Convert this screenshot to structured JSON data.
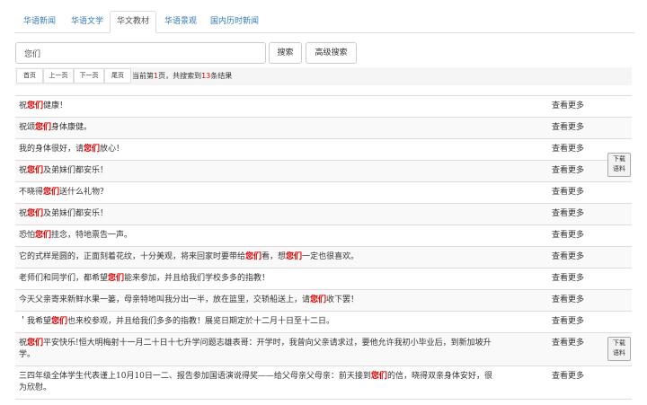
{
  "tabs": [
    {
      "label": "华语新闻"
    },
    {
      "label": "华语文学"
    },
    {
      "label": "华文教材",
      "active": true
    },
    {
      "label": "华语景观"
    },
    {
      "label": "国内历时新闻"
    }
  ],
  "search": {
    "value": "您们",
    "button_label": "搜索",
    "advanced_label": "高级搜索"
  },
  "pager": {
    "first": "首页",
    "prev": "上一页",
    "next": "下一页",
    "last": "尾页",
    "info_pre": "当前第",
    "current_page": "1",
    "info_mid": "页，共搜索到",
    "total": "13",
    "info_post": "条结果"
  },
  "results": [
    {
      "before": "祝",
      "keyword": "您们",
      "after": "健康！",
      "more": "查看更多"
    },
    {
      "before": "祝颂",
      "keyword": "您们",
      "after": "身体康健。",
      "more": "查看更多"
    },
    {
      "before": "我的身体很好，请",
      "keyword": "您们",
      "after": "放心！",
      "more": "查看更多"
    },
    {
      "before": "祝",
      "keyword": "您们",
      "after": "及弟妹们都安乐！",
      "more": "查看更多"
    },
    {
      "before": "不晓得",
      "keyword": "您们",
      "after": "送什么礼物？",
      "more": "查看更多"
    },
    {
      "before": "祝",
      "keyword": "您们",
      "after": "及弟妹们都安乐！",
      "more": "查看更多"
    },
    {
      "before": "恐怕",
      "keyword": "您们",
      "after": "挂念，特地禀告一声。",
      "more": "查看更多"
    },
    {
      "before": "它的式样是圆的，正面刻着花纹，十分美观，将来回家时要带给",
      "keyword": "您们",
      "after": "看，想",
      "keyword2": "您们",
      "after2": "一定也很喜欢。",
      "more": "查看更多"
    },
    {
      "before": "老师们和同学们，都希望",
      "keyword": "您们",
      "after": "能来参加，并且给我们学校多多的指教！",
      "more": "查看更多"
    },
    {
      "before": "今天父亲寄来新鲜水果一篓，母亲特地叫我分出一半，放在篮里，交轿船送上，请",
      "keyword": "您们",
      "after": "收下罢！",
      "more": "查看更多"
    },
    {
      "before": "＇我希望",
      "keyword": "您们",
      "after": "也来校参观，并且给我们多多的指教！展览日期定於十二月十日至十二日。",
      "more": "查看更多"
    },
    {
      "before": "祝",
      "keyword": "您们",
      "after": "平安快乐!恒大明梅射十一月二十日十七升学问题志雄表哥：开学时，我曾向父亲请求过，要他允许我初小毕业后，到新加坡升学。",
      "more": "查看更多"
    },
    {
      "before": "三四年级全体学生代表谨上10月10日一二、报告参加国语演说得奖——给父母亲父母亲：前天接到",
      "keyword": "您们",
      "after": "的信，晓得双亲身体安好，很为欣慰。",
      "more": "查看更多"
    }
  ],
  "download": {
    "label_line1": "下载",
    "label_line2": "语料"
  }
}
